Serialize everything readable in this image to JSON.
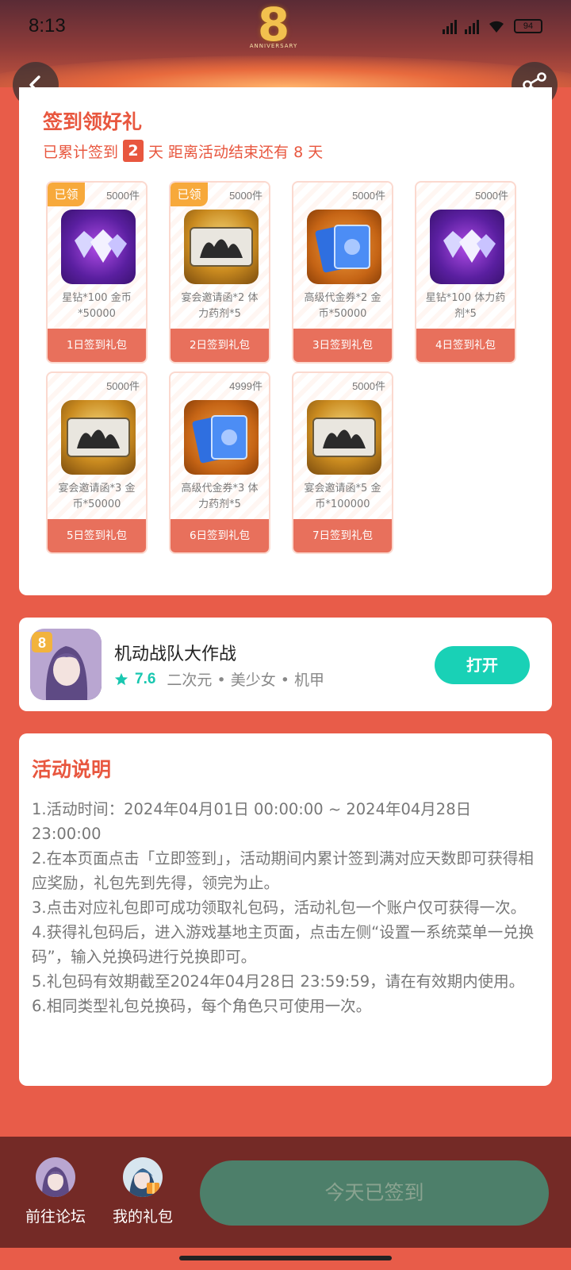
{
  "status_bar": {
    "time": "8:13",
    "battery": "94"
  },
  "signin": {
    "title": "签到领好礼",
    "status_prefix": "已累计签到",
    "days": "2",
    "status_suffix": "天 距离活动结束还有 8 天",
    "gifts": [
      {
        "stock": "5000件",
        "claimed": "已领",
        "desc": "星钻*100 金币*50000",
        "day": "1日签到礼包",
        "icon": "diamond-icon"
      },
      {
        "stock": "5000件",
        "claimed": "已领",
        "desc": "宴会邀请函*2 体力药剂*5",
        "day": "2日签到礼包",
        "icon": "invitation-icon"
      },
      {
        "stock": "5000件",
        "claimed": "",
        "desc": "高级代金券*2 金币*50000",
        "day": "3日签到礼包",
        "icon": "voucher-icon"
      },
      {
        "stock": "5000件",
        "claimed": "",
        "desc": "星钻*100 体力药剂*5",
        "day": "4日签到礼包",
        "icon": "diamond-icon"
      },
      {
        "stock": "5000件",
        "claimed": "",
        "desc": "宴会邀请函*3 金币*50000",
        "day": "5日签到礼包",
        "icon": "invitation-icon"
      },
      {
        "stock": "4999件",
        "claimed": "",
        "desc": "高级代金券*3 体力药剂*5",
        "day": "6日签到礼包",
        "icon": "voucher-icon"
      },
      {
        "stock": "5000件",
        "claimed": "",
        "desc": "宴会邀请函*5 金币*100000",
        "day": "7日签到礼包",
        "icon": "invitation-icon"
      }
    ]
  },
  "game": {
    "name": "机动战队大作战",
    "rating": "7.6",
    "tags": "二次元 • 美少女 • 机甲",
    "open_label": "打开"
  },
  "rules": {
    "title": "活动说明",
    "items": [
      "1.活动时间：2024年04月01日 00:00:00 ~ 2024年04月28日 23:00:00",
      "2.在本页面点击「立即签到」，活动期间内累计签到满对应天数即可获得相应奖励，礼包先到先得，领完为止。",
      "3.点击对应礼包即可成功领取礼包码，活动礼包一个账户仅可获得一次。",
      "4.获得礼包码后，进入游戏基地主页面，点击左侧“设置一系统菜单一兑换码”，输入兑换码进行兑换即可。",
      "5.礼包码有效期截至2024年04月28日 23:59:59，请在有效期内使用。",
      "6.相同类型礼包兑换码，每个角色只可使用一次。"
    ]
  },
  "bottom": {
    "forum_label": "前往论坛",
    "mygift_label": "我的礼包",
    "signed_label": "今天已签到"
  },
  "colors": {
    "background": "#e85c49",
    "accent": "#e8573f",
    "open_button": "#19d1b6",
    "bottom_bar": "#742a26",
    "signed_button": "#4d7f6a"
  }
}
